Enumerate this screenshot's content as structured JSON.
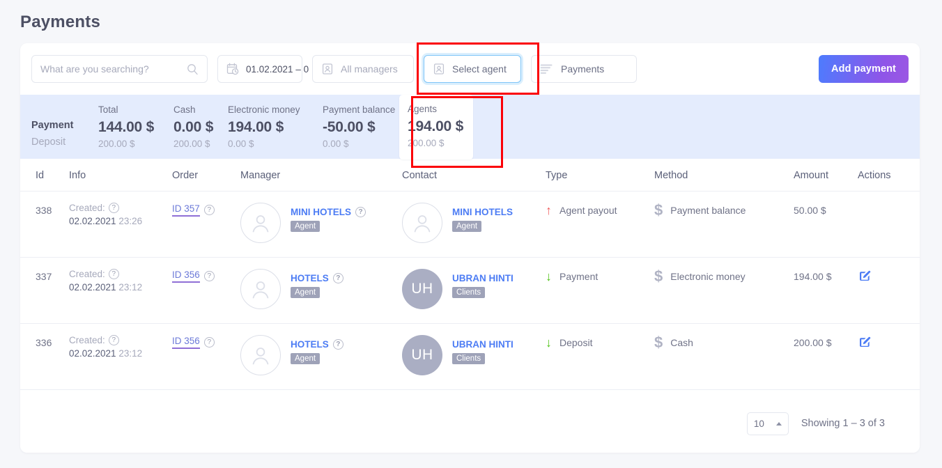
{
  "page": {
    "title": "Payments"
  },
  "toolbar": {
    "search": {
      "placeholder": "What are you searching?",
      "value": "",
      "icon": "search-icon"
    },
    "date_range": {
      "value": "01.02.2021 – 0",
      "icon": "calendar-clock-icon"
    },
    "managers_filter": {
      "value": "All managers",
      "icon": "contact-card-icon"
    },
    "agent_filter": {
      "value": "Select agent",
      "icon": "contact-card-icon"
    },
    "payment_type_filter": {
      "value": "Payments",
      "icon": "filter-lines-icon"
    },
    "add_payment_label": "Add payment"
  },
  "stats": {
    "row_labels": {
      "payment": "Payment",
      "deposit": "Deposit"
    },
    "columns": [
      {
        "label": "Total",
        "payment": "144.00 $",
        "deposit": "200.00 $"
      },
      {
        "label": "Cash",
        "payment": "0.00 $",
        "deposit": "200.00 $"
      },
      {
        "label": "Electronic money",
        "payment": "194.00 $",
        "deposit": "0.00 $"
      },
      {
        "label": "Payment balance",
        "payment": "-50.00 $",
        "deposit": "0.00 $"
      }
    ],
    "agents_card": {
      "label": "Agents",
      "payment": "194.00 $",
      "deposit": "200.00 $"
    }
  },
  "table": {
    "headers": {
      "id": "Id",
      "info": "Info",
      "order": "Order",
      "manager": "Manager",
      "contact": "Contact",
      "type": "Type",
      "method": "Method",
      "amount": "Amount",
      "actions": "Actions"
    },
    "rows": [
      {
        "id": "338",
        "info_label": "Created:",
        "info_date": "02.02.2021",
        "info_time": "23:26",
        "order_id": "ID 357",
        "manager": {
          "name": "MINI HOTELS",
          "badge": "Agent",
          "avatar_type": "silhouette",
          "initials": ""
        },
        "contact": {
          "name": "MINI HOTELS",
          "badge": "Agent",
          "avatar_type": "silhouette",
          "initials": ""
        },
        "type": "Agent payout",
        "type_direction": "up",
        "method": "Payment balance",
        "amount": "50.00 $",
        "has_edit": false
      },
      {
        "id": "337",
        "info_label": "Created:",
        "info_date": "02.02.2021",
        "info_time": "23:12",
        "order_id": "ID 356",
        "manager": {
          "name": "HOTELS",
          "badge": "Agent",
          "avatar_type": "silhouette",
          "initials": ""
        },
        "contact": {
          "name": "UBRAN HINTI",
          "badge": "Clients",
          "avatar_type": "initials",
          "initials": "UH"
        },
        "type": "Payment",
        "type_direction": "down",
        "method": "Electronic money",
        "amount": "194.00 $",
        "has_edit": true
      },
      {
        "id": "336",
        "info_label": "Created:",
        "info_date": "02.02.2021",
        "info_time": "23:12",
        "order_id": "ID 356",
        "manager": {
          "name": "HOTELS",
          "badge": "Agent",
          "avatar_type": "silhouette",
          "initials": ""
        },
        "contact": {
          "name": "UBRAN HINTI",
          "badge": "Clients",
          "avatar_type": "initials",
          "initials": "UH"
        },
        "type": "Deposit",
        "type_direction": "down",
        "method": "Cash",
        "amount": "200.00 $",
        "has_edit": true
      }
    ]
  },
  "footer": {
    "per_page": "10",
    "showing": "Showing 1 – 3 of 3"
  },
  "annotations": {
    "color": "#fb0007",
    "boxes": [
      {
        "name": "agent-filter-highlight"
      },
      {
        "name": "agents-stat-highlight"
      }
    ]
  },
  "colors": {
    "accent_blue": "#4c7cf4",
    "accent_purple": "#9b57e3",
    "stats_band": "#e4ecfd",
    "page_bg": "#f6f7fa",
    "up_arrow": "#f06060",
    "down_arrow": "#52c41a",
    "annotation": "#fb0007"
  }
}
